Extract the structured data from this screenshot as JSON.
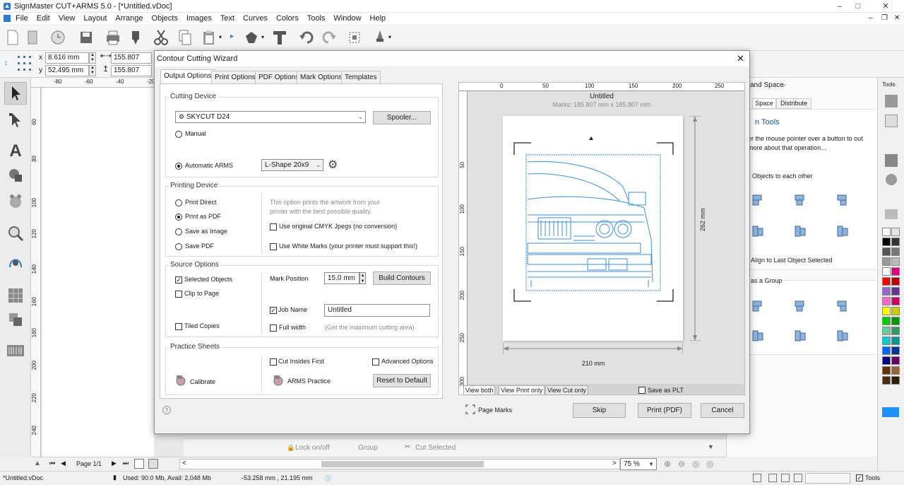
{
  "window": {
    "title": "SignMaster CUT+ARMS 5.0 - [*Untitled.vDoc]"
  },
  "menu": [
    "File",
    "Edit",
    "View",
    "Layout",
    "Arrange",
    "Objects",
    "Images",
    "Text",
    "Curves",
    "Colors",
    "Tools",
    "Window",
    "Help"
  ],
  "propbar": {
    "x_label": "x",
    "x_value": "8.616 mm",
    "y_label": "y",
    "y_value": "52.495 mm",
    "w_value": "155.807 mm",
    "h_value": "155.807 mm"
  },
  "ruler_top": [
    "-80",
    "-60",
    "-40",
    "-20"
  ],
  "ruler_left": [
    "60",
    "80",
    "100",
    "120",
    "140",
    "160",
    "180",
    "200",
    "220",
    "240"
  ],
  "right_panel": {
    "header_left": "and Space",
    "tools_label": "Tools",
    "tabs": [
      "Space",
      "Distribute"
    ],
    "section_title": "n Tools",
    "hint": "er the mouse pointer over a button to out more about that operation...",
    "align_each": "Objects to each other",
    "align_last": "Align to Last Object Selected",
    "as_group": "as a Group"
  },
  "bottombar": {
    "page": "Page 1/1",
    "zoom": "75 %"
  },
  "under_dialog": {
    "lock": "Lock on/off",
    "group": "Group",
    "cut_selected": "Cut Selected"
  },
  "status": {
    "file": "*Untitled.vDoc",
    "memory": "Used: 90.0 Mb, Avail: 2,048 Mb",
    "coords": "-53.258 mm , 21.195 mm",
    "tools": "Tools"
  },
  "dialog": {
    "title": "Contour Cutting Wizard",
    "tabs": [
      "Output Options",
      "Print Options",
      "PDF Options",
      "Mark Options",
      "Templates"
    ],
    "cutting_device": {
      "label": "Cutting Device",
      "device": "SKYCUT D24",
      "spooler": "Spooler...",
      "manual": "Manual",
      "auto_arms": "Automatic ARMS",
      "arms_shape": "L-Shape 20x9"
    },
    "printing_device": {
      "label": "Printing Device",
      "print_direct": "Print Direct",
      "print_pdf": "Print as PDF",
      "save_image": "Save as Image",
      "save_pdf": "Save PDF",
      "hint": "This option prints the artwork from your printer with the best possible quality.",
      "cmyk": "Use original CMYK Jpegs (no conversion)",
      "white_marks": "Use White Marks (your printer must support this!)"
    },
    "source_options": {
      "label": "Source Options",
      "selected": "Selected Objects",
      "clip": "Clip to Page",
      "tiled": "Tiled Copies",
      "mark_position": "Mark Position",
      "mark_value": "15.0 mm",
      "build": "Build Contours",
      "job_name": "Job Name",
      "job_value": "Untitled",
      "full_width": "Full width",
      "full_width_hint": "(Get the maximum cutting area)"
    },
    "practice": {
      "label": "Practice Sheets",
      "calibrate": "Calibrate",
      "cut_insides": "Cut Insides First",
      "advanced": "Advanced Options",
      "arms_practice": "ARMS Practice",
      "reset": "Reset to Default"
    },
    "preview": {
      "title": "Untitled",
      "marks": "Marks: 185.807 mm x 185.807 mm",
      "height": "262 mm",
      "width": "210 mm",
      "ruler_top": [
        "0",
        "50",
        "100",
        "150",
        "200",
        "250"
      ],
      "ruler_left": [
        "50",
        "100",
        "150",
        "200",
        "250",
        "300"
      ],
      "tabs": [
        "View both",
        "View Print only",
        "View Cut only"
      ],
      "save_plt": "Save as PLT",
      "page_marks": "Page Marks"
    },
    "buttons": {
      "skip": "Skip",
      "print": "Print (PDF)",
      "cancel": "Cancel"
    }
  },
  "palette": [
    "#ffffff",
    "#e6e6e6",
    "#000000",
    "#333333",
    "#555555",
    "#777777",
    "#999999",
    "#bbbbbb",
    "#ffffff",
    "#e6007e",
    "#ff0000",
    "#c00000",
    "#9966cc",
    "#663399",
    "#ff66cc",
    "#cc0066",
    "#ffff00",
    "#cccc00",
    "#00cc00",
    "#009900",
    "#66cc99",
    "#339966",
    "#00cccc",
    "#009999",
    "#0066ff",
    "#003399",
    "#000080",
    "#660066",
    "#663300",
    "#996633",
    "#4a2b12",
    "#2e1a0a"
  ],
  "palette_accent": "#1e90ff"
}
